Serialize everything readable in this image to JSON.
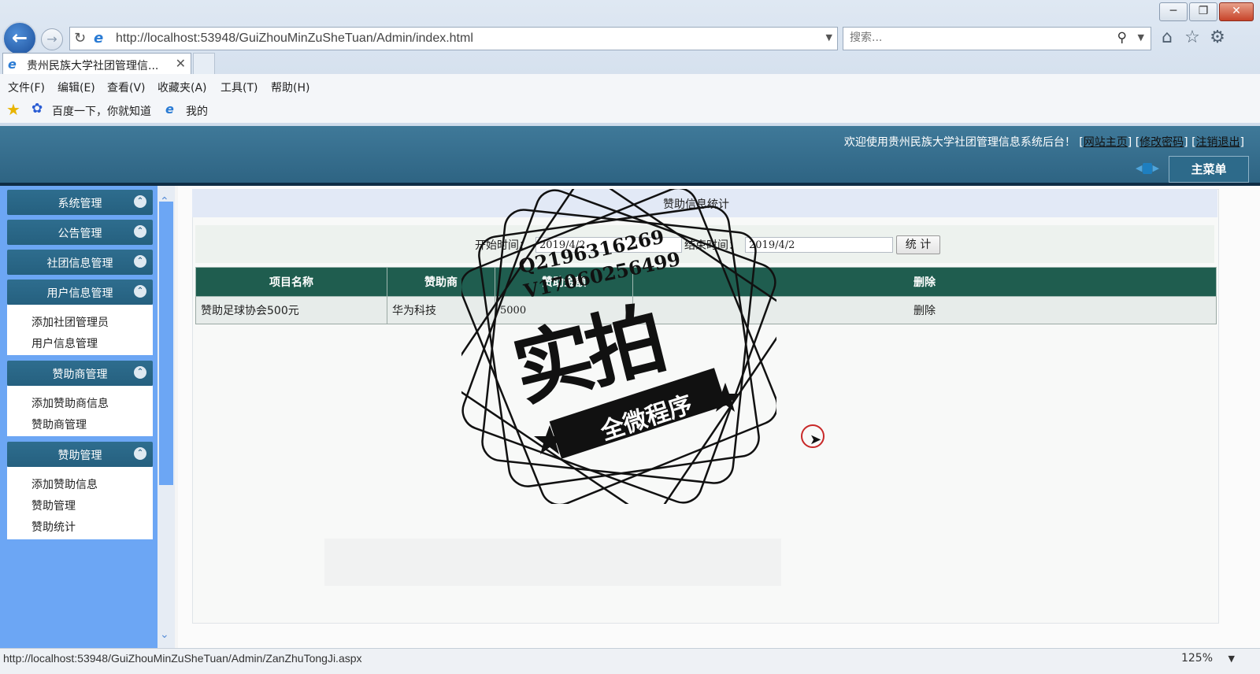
{
  "browser": {
    "url": "http://localhost:53948/GuiZhouMinZuSheTuan/Admin/index.html",
    "search_placeholder": "搜索...",
    "tab_title": "贵州民族大学社团管理信...",
    "menu": [
      "文件(F)",
      "编辑(E)",
      "查看(V)",
      "收藏夹(A)",
      "工具(T)",
      "帮助(H)"
    ],
    "favorites": [
      "百度一下，你就知道",
      "我的"
    ],
    "status_url": "http://localhost:53948/GuiZhouMinZuSheTuan/Admin/ZanZhuTongJi.aspx",
    "zoom": "125%"
  },
  "header": {
    "welcome": "欢迎使用贵州民族大学社团管理信息系统后台！",
    "links": [
      "网站主页",
      "修改密码",
      "注销退出"
    ],
    "main_menu": "主菜单"
  },
  "sidebar": {
    "groups": [
      {
        "title": "系统管理",
        "items": []
      },
      {
        "title": "公告管理",
        "items": []
      },
      {
        "title": "社团信息管理",
        "items": []
      },
      {
        "title": "用户信息管理",
        "items": [
          "添加社团管理员",
          "用户信息管理"
        ]
      },
      {
        "title": "赞助商管理",
        "items": [
          "添加赞助商信息",
          "赞助商管理"
        ]
      },
      {
        "title": "赞助管理",
        "items": [
          "添加赞助信息",
          "赞助管理",
          "赞助统计"
        ]
      }
    ]
  },
  "main": {
    "title": "赞助信息统计",
    "start_label": "开始时间：",
    "start_value": "2019/4/2",
    "end_label": "结束时间：",
    "end_value": "2019/4/2",
    "stat_button": "统 计",
    "table": {
      "headers": [
        "项目名称",
        "赞助商",
        "赞助金额",
        "删除"
      ],
      "rows": [
        [
          "赞助足球协会500元",
          "华为科技",
          "5000",
          "删除"
        ]
      ]
    }
  },
  "watermark": {
    "line1": "Q2196316269",
    "line2": "V17060256499",
    "big": "实拍",
    "ribbon": "全微程序"
  }
}
